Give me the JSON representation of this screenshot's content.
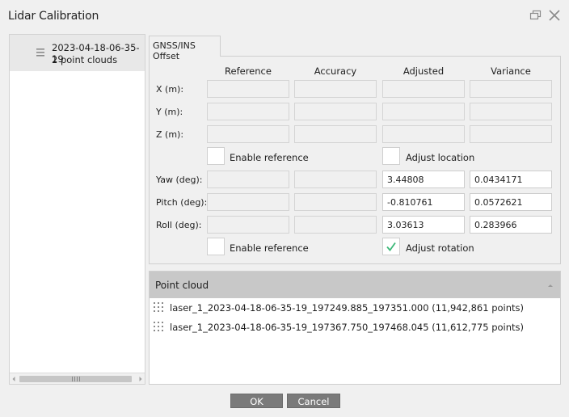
{
  "window": {
    "title": "Lidar Calibration"
  },
  "sidebar": {
    "session": {
      "name": "2023-04-18-06-35-19",
      "subtitle": "2 point clouds"
    }
  },
  "tabs": [
    {
      "label": "GNSS/INS Offset",
      "active": true
    }
  ],
  "offset": {
    "columns": [
      "Reference",
      "Accuracy",
      "Adjusted",
      "Variance"
    ],
    "location_rows": [
      {
        "label": "X (m):",
        "reference": "",
        "accuracy": "",
        "adjusted": "",
        "variance": ""
      },
      {
        "label": "Y (m):",
        "reference": "",
        "accuracy": "",
        "adjusted": "",
        "variance": ""
      },
      {
        "label": "Z (m):",
        "reference": "",
        "accuracy": "",
        "adjusted": "",
        "variance": ""
      }
    ],
    "location_checks": {
      "enable_reference": {
        "label": "Enable reference",
        "checked": false
      },
      "adjust": {
        "label": "Adjust location",
        "checked": false
      }
    },
    "rotation_rows": [
      {
        "label": "Yaw (deg):",
        "reference": "",
        "accuracy": "",
        "adjusted": "3.44808",
        "variance": "0.0434171"
      },
      {
        "label": "Pitch (deg):",
        "reference": "",
        "accuracy": "",
        "adjusted": "-0.810761",
        "variance": "0.0572621"
      },
      {
        "label": "Roll (deg):",
        "reference": "",
        "accuracy": "",
        "adjusted": "3.03613",
        "variance": "0.283966"
      }
    ],
    "rotation_checks": {
      "enable_reference": {
        "label": "Enable reference",
        "checked": false
      },
      "adjust": {
        "label": "Adjust rotation",
        "checked": true
      }
    }
  },
  "point_cloud": {
    "header": "Point cloud",
    "items": [
      "laser_1_2023-04-18-06-35-19_197249.885_197351.000 (11,942,861 points)",
      "laser_1_2023-04-18-06-35-19_197367.750_197468.045 (11,612,775 points)"
    ]
  },
  "footer": {
    "ok_label": "OK",
    "cancel_label": "Cancel"
  },
  "colors": {
    "background": "#f0f0f0",
    "selected_item": "#e8e8e8",
    "section_header": "#c8c8c8",
    "button": "#7a7a7a",
    "check_mark": "#3cb878"
  }
}
